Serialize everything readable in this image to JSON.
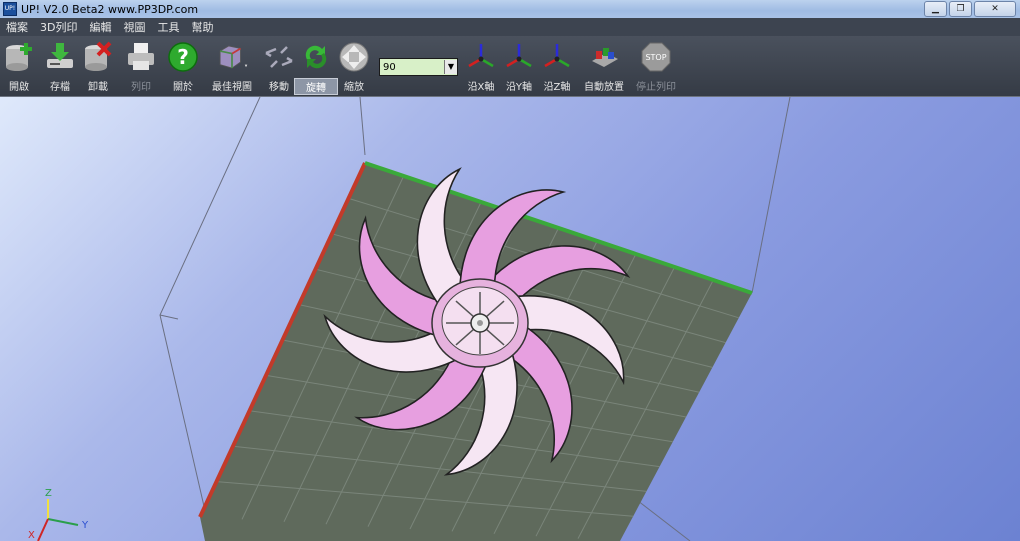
{
  "window": {
    "title": "UP!  V2.0 Beta2 www.PP3DP.com",
    "app_icon_text": "UP!",
    "minimize_glyph": "▁",
    "restore_glyph": "❐",
    "close_glyph": "✕"
  },
  "menu": [
    "檔案",
    "3D列印",
    "編輯",
    "視圖",
    "工具",
    "幫助"
  ],
  "toolbar": {
    "open": "開啟",
    "save": "存檔",
    "unload": "卸載",
    "print": "列印",
    "about": "關於",
    "best_view": "最佳視圖",
    "move": "移動",
    "rotate": "旋轉",
    "scale": "縮放",
    "value": "90",
    "x_axis": "沿X軸",
    "y_axis": "沿Y軸",
    "z_axis": "沿Z軸",
    "auto_place": "自動放置",
    "stop_print": "停止列印",
    "stop_icon_text": "STOP"
  },
  "viewport": {
    "axis_x": "X",
    "axis_y": "Y",
    "axis_z": "Z",
    "platform_color": "#5f6a5c",
    "model_color": "#e79fe0"
  }
}
